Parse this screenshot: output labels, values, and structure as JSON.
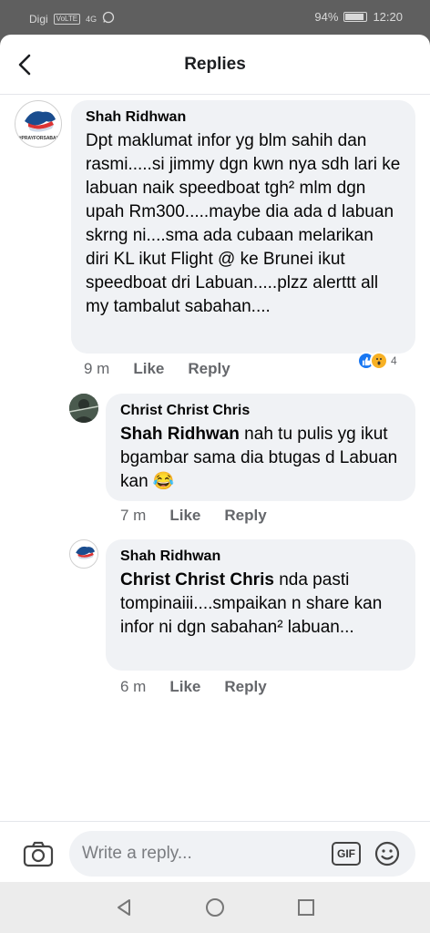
{
  "status_bar": {
    "carrier": "Digi",
    "carrier_badge": "VoLTE",
    "network": "4G",
    "battery": "94%",
    "time": "12:20"
  },
  "header": {
    "title": "Replies"
  },
  "comments": [
    {
      "author": "Shah Ridhwan",
      "avatar_caption": "#PRAYFORSABAH",
      "text": "Dpt maklumat infor yg blm sahih dan rasmi.....si jimmy dgn kwn nya sdh lari ke labuan naik speedboat tgh² mlm dgn upah Rm300.....maybe dia ada d labuan skrng ni....sma ada cubaan melarikan diri KL ikut Flight @ ke Brunei ikut speedboat dri Labuan.....plzz alerttt all my tambalut sabahan....",
      "time": "9 m",
      "like_label": "Like",
      "reply_label": "Reply",
      "reaction_count": "4",
      "reaction_icons": [
        "like-reaction",
        "wow-reaction"
      ]
    }
  ],
  "replies": [
    {
      "author": "Christ Christ Chris",
      "mention": "Shah Ridhwan",
      "text": " nah tu pulis yg ikut bgambar sama dia btugas d Labuan kan 😂",
      "time": "7 m",
      "like_label": "Like",
      "reply_label": "Reply"
    },
    {
      "author": "Shah Ridhwan",
      "mention": "Christ Christ Chris",
      "text": " nda pasti tompinaiii....smpaikan n share kan  infor ni dgn sabahan² labuan...",
      "time": "6 m",
      "like_label": "Like",
      "reply_label": "Reply"
    }
  ],
  "composer": {
    "placeholder": "Write a reply...",
    "gif_label": "GIF"
  },
  "colors": {
    "bubble": "#f0f2f5",
    "like_blue": "#1877f2",
    "wow_yellow": "#f7b125",
    "meta_gray": "#65676b"
  }
}
